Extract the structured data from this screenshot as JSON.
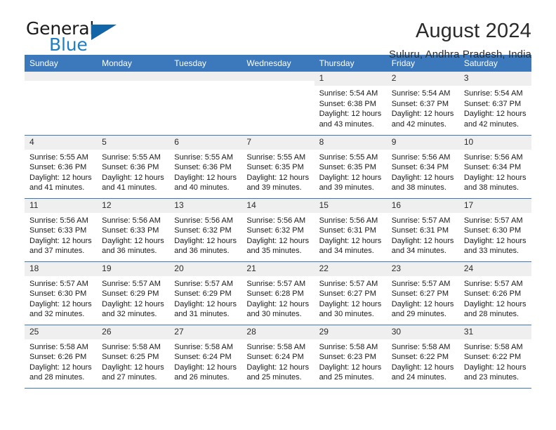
{
  "brand": {
    "name_part1": "General",
    "name_part2": "Blue",
    "triangle_color": "#1266a8",
    "blue_color": "#1d7fc3"
  },
  "header": {
    "title": "August 2024",
    "subtitle": "Suluru, Andhra Pradesh, India"
  },
  "calendar": {
    "header_bg": "#3b78bc",
    "daynum_bg": "#efefef",
    "weekdays": [
      "Sunday",
      "Monday",
      "Tuesday",
      "Wednesday",
      "Thursday",
      "Friday",
      "Saturday"
    ],
    "weeks": [
      [
        {
          "day": "",
          "empty": true
        },
        {
          "day": "",
          "empty": true
        },
        {
          "day": "",
          "empty": true
        },
        {
          "day": "",
          "empty": true
        },
        {
          "day": "1",
          "sunrise": "Sunrise: 5:54 AM",
          "sunset": "Sunset: 6:38 PM",
          "daylight1": "Daylight: 12 hours",
          "daylight2": "and 43 minutes."
        },
        {
          "day": "2",
          "sunrise": "Sunrise: 5:54 AM",
          "sunset": "Sunset: 6:37 PM",
          "daylight1": "Daylight: 12 hours",
          "daylight2": "and 42 minutes."
        },
        {
          "day": "3",
          "sunrise": "Sunrise: 5:54 AM",
          "sunset": "Sunset: 6:37 PM",
          "daylight1": "Daylight: 12 hours",
          "daylight2": "and 42 minutes."
        }
      ],
      [
        {
          "day": "4",
          "sunrise": "Sunrise: 5:55 AM",
          "sunset": "Sunset: 6:36 PM",
          "daylight1": "Daylight: 12 hours",
          "daylight2": "and 41 minutes."
        },
        {
          "day": "5",
          "sunrise": "Sunrise: 5:55 AM",
          "sunset": "Sunset: 6:36 PM",
          "daylight1": "Daylight: 12 hours",
          "daylight2": "and 41 minutes."
        },
        {
          "day": "6",
          "sunrise": "Sunrise: 5:55 AM",
          "sunset": "Sunset: 6:36 PM",
          "daylight1": "Daylight: 12 hours",
          "daylight2": "and 40 minutes."
        },
        {
          "day": "7",
          "sunrise": "Sunrise: 5:55 AM",
          "sunset": "Sunset: 6:35 PM",
          "daylight1": "Daylight: 12 hours",
          "daylight2": "and 39 minutes."
        },
        {
          "day": "8",
          "sunrise": "Sunrise: 5:55 AM",
          "sunset": "Sunset: 6:35 PM",
          "daylight1": "Daylight: 12 hours",
          "daylight2": "and 39 minutes."
        },
        {
          "day": "9",
          "sunrise": "Sunrise: 5:56 AM",
          "sunset": "Sunset: 6:34 PM",
          "daylight1": "Daylight: 12 hours",
          "daylight2": "and 38 minutes."
        },
        {
          "day": "10",
          "sunrise": "Sunrise: 5:56 AM",
          "sunset": "Sunset: 6:34 PM",
          "daylight1": "Daylight: 12 hours",
          "daylight2": "and 38 minutes."
        }
      ],
      [
        {
          "day": "11",
          "sunrise": "Sunrise: 5:56 AM",
          "sunset": "Sunset: 6:33 PM",
          "daylight1": "Daylight: 12 hours",
          "daylight2": "and 37 minutes."
        },
        {
          "day": "12",
          "sunrise": "Sunrise: 5:56 AM",
          "sunset": "Sunset: 6:33 PM",
          "daylight1": "Daylight: 12 hours",
          "daylight2": "and 36 minutes."
        },
        {
          "day": "13",
          "sunrise": "Sunrise: 5:56 AM",
          "sunset": "Sunset: 6:32 PM",
          "daylight1": "Daylight: 12 hours",
          "daylight2": "and 36 minutes."
        },
        {
          "day": "14",
          "sunrise": "Sunrise: 5:56 AM",
          "sunset": "Sunset: 6:32 PM",
          "daylight1": "Daylight: 12 hours",
          "daylight2": "and 35 minutes."
        },
        {
          "day": "15",
          "sunrise": "Sunrise: 5:56 AM",
          "sunset": "Sunset: 6:31 PM",
          "daylight1": "Daylight: 12 hours",
          "daylight2": "and 34 minutes."
        },
        {
          "day": "16",
          "sunrise": "Sunrise: 5:57 AM",
          "sunset": "Sunset: 6:31 PM",
          "daylight1": "Daylight: 12 hours",
          "daylight2": "and 34 minutes."
        },
        {
          "day": "17",
          "sunrise": "Sunrise: 5:57 AM",
          "sunset": "Sunset: 6:30 PM",
          "daylight1": "Daylight: 12 hours",
          "daylight2": "and 33 minutes."
        }
      ],
      [
        {
          "day": "18",
          "sunrise": "Sunrise: 5:57 AM",
          "sunset": "Sunset: 6:30 PM",
          "daylight1": "Daylight: 12 hours",
          "daylight2": "and 32 minutes."
        },
        {
          "day": "19",
          "sunrise": "Sunrise: 5:57 AM",
          "sunset": "Sunset: 6:29 PM",
          "daylight1": "Daylight: 12 hours",
          "daylight2": "and 32 minutes."
        },
        {
          "day": "20",
          "sunrise": "Sunrise: 5:57 AM",
          "sunset": "Sunset: 6:29 PM",
          "daylight1": "Daylight: 12 hours",
          "daylight2": "and 31 minutes."
        },
        {
          "day": "21",
          "sunrise": "Sunrise: 5:57 AM",
          "sunset": "Sunset: 6:28 PM",
          "daylight1": "Daylight: 12 hours",
          "daylight2": "and 30 minutes."
        },
        {
          "day": "22",
          "sunrise": "Sunrise: 5:57 AM",
          "sunset": "Sunset: 6:27 PM",
          "daylight1": "Daylight: 12 hours",
          "daylight2": "and 30 minutes."
        },
        {
          "day": "23",
          "sunrise": "Sunrise: 5:57 AM",
          "sunset": "Sunset: 6:27 PM",
          "daylight1": "Daylight: 12 hours",
          "daylight2": "and 29 minutes."
        },
        {
          "day": "24",
          "sunrise": "Sunrise: 5:57 AM",
          "sunset": "Sunset: 6:26 PM",
          "daylight1": "Daylight: 12 hours",
          "daylight2": "and 28 minutes."
        }
      ],
      [
        {
          "day": "25",
          "sunrise": "Sunrise: 5:58 AM",
          "sunset": "Sunset: 6:26 PM",
          "daylight1": "Daylight: 12 hours",
          "daylight2": "and 28 minutes."
        },
        {
          "day": "26",
          "sunrise": "Sunrise: 5:58 AM",
          "sunset": "Sunset: 6:25 PM",
          "daylight1": "Daylight: 12 hours",
          "daylight2": "and 27 minutes."
        },
        {
          "day": "27",
          "sunrise": "Sunrise: 5:58 AM",
          "sunset": "Sunset: 6:24 PM",
          "daylight1": "Daylight: 12 hours",
          "daylight2": "and 26 minutes."
        },
        {
          "day": "28",
          "sunrise": "Sunrise: 5:58 AM",
          "sunset": "Sunset: 6:24 PM",
          "daylight1": "Daylight: 12 hours",
          "daylight2": "and 25 minutes."
        },
        {
          "day": "29",
          "sunrise": "Sunrise: 5:58 AM",
          "sunset": "Sunset: 6:23 PM",
          "daylight1": "Daylight: 12 hours",
          "daylight2": "and 25 minutes."
        },
        {
          "day": "30",
          "sunrise": "Sunrise: 5:58 AM",
          "sunset": "Sunset: 6:22 PM",
          "daylight1": "Daylight: 12 hours",
          "daylight2": "and 24 minutes."
        },
        {
          "day": "31",
          "sunrise": "Sunrise: 5:58 AM",
          "sunset": "Sunset: 6:22 PM",
          "daylight1": "Daylight: 12 hours",
          "daylight2": "and 23 minutes."
        }
      ]
    ]
  }
}
